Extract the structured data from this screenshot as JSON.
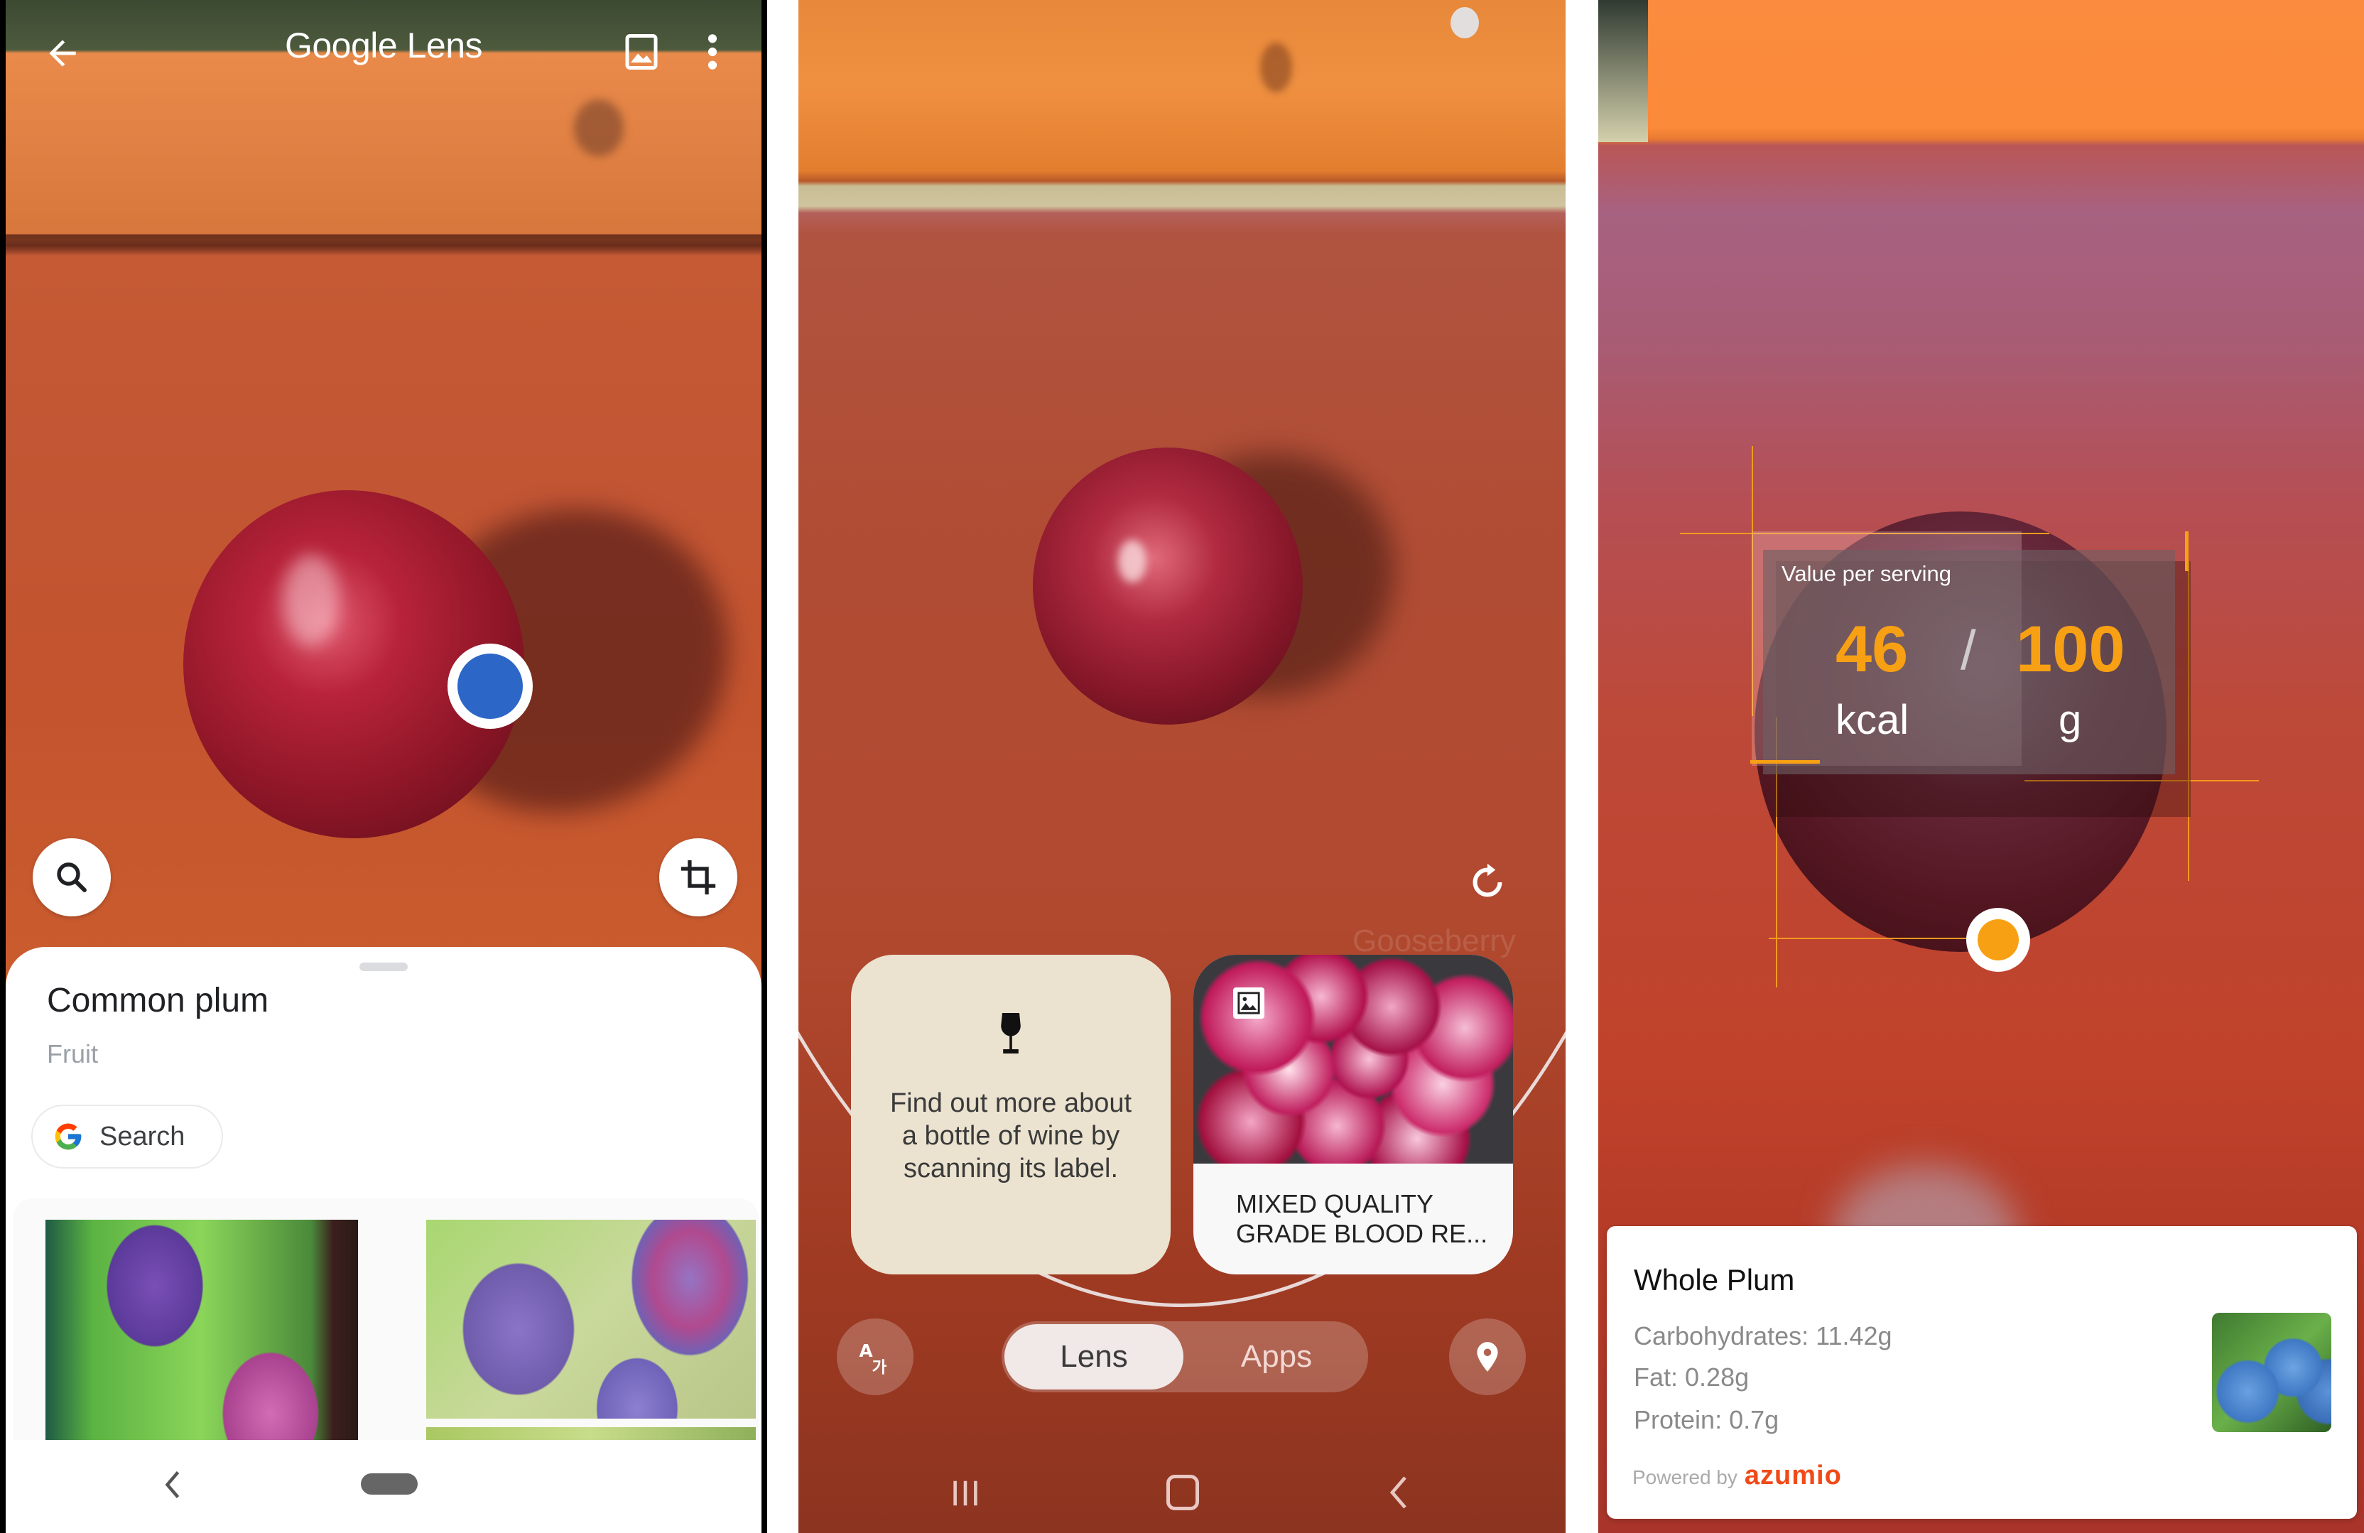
{
  "panel1": {
    "app_title": "Google Lens",
    "icons": {
      "back": "arrow-left-icon",
      "gallery": "image-gallery-icon",
      "more": "more-vert-icon",
      "search": "search-icon",
      "crop": "crop-icon"
    },
    "result": {
      "title": "Common plum",
      "subtitle": "Fruit",
      "search_button_label": "Search"
    },
    "similar_images_count": 3,
    "nav": {
      "back": "nav-back-icon",
      "home": "nav-home-pill"
    }
  },
  "panel2": {
    "watermark": "Gooseberry",
    "suggestion_cards": [
      {
        "type": "tip",
        "icon": "wine-glass-icon",
        "text": "Find out more about a bottle of wine by scanning its label."
      },
      {
        "type": "image-result",
        "icon": "image-icon",
        "title": "MIXED QUALITY GRADE BLOOD RE..."
      }
    ],
    "modes": [
      {
        "label": "Lens",
        "selected": true
      },
      {
        "label": "Apps",
        "selected": false
      }
    ],
    "toolbar_icons": {
      "left": "translate-icon",
      "right": "location-pin-icon",
      "refresh": "refresh-icon"
    },
    "nav": {
      "recent": "recent-apps-icon",
      "home": "home-icon",
      "back": "back-icon"
    }
  },
  "panel3": {
    "overlay": {
      "label": "Value per serving",
      "energy_value": "46",
      "energy_unit": "kcal",
      "separator": "/",
      "serving_value": "100",
      "serving_unit": "g"
    },
    "card": {
      "title": "Whole Plum",
      "carbohydrates": "Carbohydrates: 11.42g",
      "fat": "Fat: 0.28g",
      "protein": "Protein: 0.7g",
      "powered_by": "Powered by",
      "brand": "azumio"
    },
    "colors": {
      "accent": "#f8a014",
      "brand": "#f04a18"
    }
  }
}
